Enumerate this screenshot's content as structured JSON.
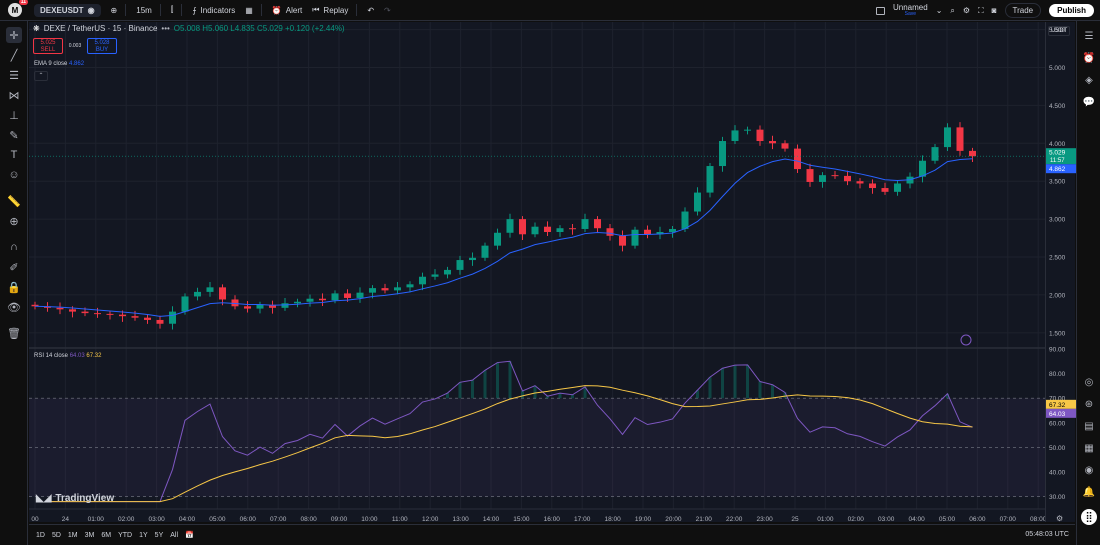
{
  "topbar": {
    "avatar_letter": "M",
    "avatar_badge": "11",
    "symbol": "DEXEUSDT",
    "interval": "15m",
    "indicators_label": "Indicators",
    "alert_label": "Alert",
    "replay_label": "Replay",
    "layout_name": "Unnamed",
    "layout_status": "Save",
    "trade_label": "Trade",
    "publish_label": "Publish"
  },
  "legend": {
    "title": "DEXE / TetherUS · 15 · Binance",
    "ohlc": "O5.008 H5.060 L4.835 C5.029 +0.120 (+2.44%)",
    "sell_price": "5.025",
    "sell_label": "SELL",
    "spread": "0.003",
    "buy_price": "5.028",
    "buy_label": "BUY"
  },
  "ema": {
    "label": "EMA 9 close",
    "value": "4.862"
  },
  "rsi": {
    "label": "RSI 14 close",
    "value1": "64.03",
    "value2": "67.32"
  },
  "price_axis": {
    "currency": "USDT",
    "ticks": [
      "5.500",
      "5.000",
      "4.500",
      "4.000",
      "3.500",
      "3.000",
      "2.500",
      "2.000",
      "1.500"
    ],
    "last_price": "5.029",
    "countdown": "11:57",
    "ema_price": "4.862"
  },
  "rsi_axis": {
    "ticks": [
      "90.00",
      "80.00",
      "70.00",
      "60.00",
      "50.00",
      "40.00",
      "30.00"
    ],
    "rsi_tag": "64.03",
    "ma_tag": "67.32"
  },
  "time_axis": {
    "ticks": [
      "00",
      "24",
      "01:00",
      "02:00",
      "03:00",
      "04:00",
      "05:00",
      "06:00",
      "07:00",
      "08:00",
      "09:00",
      "10:00",
      "11:00",
      "12:00",
      "13:00",
      "14:00",
      "15:00",
      "16:00",
      "17:00",
      "18:00",
      "19:00",
      "20:00",
      "21:00",
      "22:00",
      "23:00",
      "25",
      "01:00",
      "02:00",
      "03:00",
      "04:00",
      "05:00",
      "06:00",
      "07:00",
      "08:00"
    ]
  },
  "branding": {
    "logo_text": "TradingView"
  },
  "bottombar": {
    "ranges": [
      "1D",
      "5D",
      "1M",
      "3M",
      "6M",
      "YTD",
      "1Y",
      "5Y",
      "All"
    ],
    "clock": "05:48:03 UTC"
  },
  "colors": {
    "up": "#089981",
    "down": "#f23645",
    "ema": "#2962ff",
    "rsi": "#7e57c2",
    "rsi_ma": "#f7c747",
    "bg": "#131722"
  },
  "chart_data": {
    "type": "candlestick",
    "candle_count": 76,
    "closes": [
      1.85,
      1.83,
      1.81,
      1.78,
      1.76,
      1.75,
      1.74,
      1.72,
      1.7,
      1.67,
      1.62,
      1.78,
      1.98,
      2.04,
      2.1,
      1.94,
      1.85,
      1.82,
      1.87,
      1.83,
      1.89,
      1.91,
      1.95,
      1.93,
      2.02,
      1.96,
      2.03,
      2.09,
      2.06,
      2.1,
      2.14,
      2.24,
      2.27,
      2.33,
      2.46,
      2.49,
      2.65,
      2.82,
      3.0,
      2.8,
      2.9,
      2.83,
      2.88,
      2.87,
      3.0,
      2.88,
      2.78,
      2.65,
      2.86,
      2.8,
      2.83,
      2.87,
      3.1,
      3.35,
      3.7,
      4.03,
      4.17,
      4.18,
      4.03,
      4.0,
      3.93,
      3.66,
      3.49,
      3.58,
      3.57,
      3.5,
      3.47,
      3.41,
      3.36,
      3.47,
      3.56,
      3.77,
      3.95,
      4.21,
      3.9,
      3.83
    ],
    "ema_end": 4.862,
    "rsi_end": 64.03,
    "rsi_ma_end": 67.32,
    "ylim": [
      1.3,
      5.6
    ],
    "rsi_ylim": [
      25,
      90
    ]
  }
}
